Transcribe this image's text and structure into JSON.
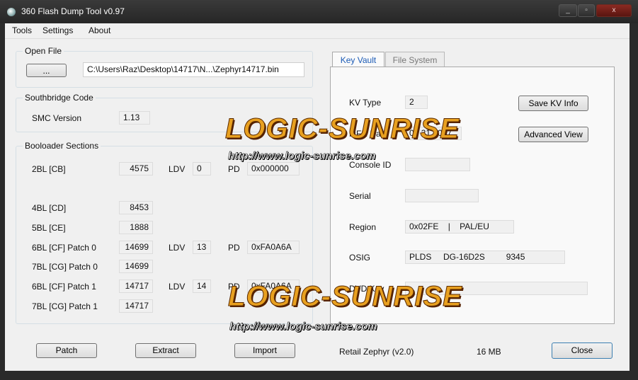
{
  "window": {
    "title": "360 Flash Dump Tool  v0.97",
    "min_glyph": "_",
    "max_glyph": "▫",
    "close_glyph": "x"
  },
  "menu": {
    "tools": "Tools",
    "settings": "Settings",
    "about": "About"
  },
  "open_file": {
    "group_label": "Open File",
    "browse_label": "...",
    "path": "C:\\Users\\Raz\\Desktop\\14717\\N...\\Zephyr14717.bin"
  },
  "southbridge": {
    "group_label": "Southbridge Code",
    "smc_label": "SMC Version",
    "smc_value": "1.13"
  },
  "bootloader": {
    "group_label": "Booloader Sections",
    "ldv_label": "LDV",
    "pd_label": "PD",
    "rows": {
      "cb": {
        "label": "2BL [CB]",
        "value": "4575",
        "ldv": "0",
        "pd": "0x000000"
      },
      "cd": {
        "label": "4BL [CD]",
        "value": "8453"
      },
      "ce": {
        "label": "5BL [CE]",
        "value": "1888"
      },
      "cf0": {
        "label": "6BL [CF] Patch 0",
        "value": "14699",
        "ldv": "13",
        "pd": "0xFA0A6A"
      },
      "cg0": {
        "label": "7BL [CG] Patch 0",
        "value": "14699"
      },
      "cf1": {
        "label": "6BL [CF] Patch 1",
        "value": "14717",
        "ldv": "14",
        "pd": "0xFA0A6A"
      },
      "cg1": {
        "label": "7BL [CG] Patch 1",
        "value": "14717"
      }
    }
  },
  "tabs": {
    "key_vault": "Key Vault",
    "file_system": "File System"
  },
  "key_vault": {
    "kv_type_label": "KV Type",
    "kv_type_value": "2",
    "mfr_date_label": "MFR Date",
    "mfr_date_value": "09 21 2007",
    "console_id_label": "Console ID",
    "console_id_value": "",
    "serial_label": "Serial",
    "serial_value": "",
    "region_label": "Region",
    "region_value": "0x02FE    |    PAL/EU",
    "osig_label": "OSIG",
    "osig_value": "PLDS     DG-16D2S         9345",
    "dvd_key_label": "DVD Key",
    "dvd_key_value": "",
    "save_kv_label": "Save KV Info",
    "advanced_view_label": "Advanced View"
  },
  "footer": {
    "patch_label": "Patch",
    "extract_label": "Extract",
    "import_label": "Import",
    "console_type": "Retail Zephyr (v2.0)",
    "flash_size": "16 MB",
    "close_label": "Close"
  },
  "watermark": {
    "brand": "LOGIC-SUNRISE",
    "url": "http://www.logic-sunrise.com"
  },
  "colors": {
    "tab_active_text": "#1c5bb5",
    "watermark_orange": "#e8a020"
  }
}
